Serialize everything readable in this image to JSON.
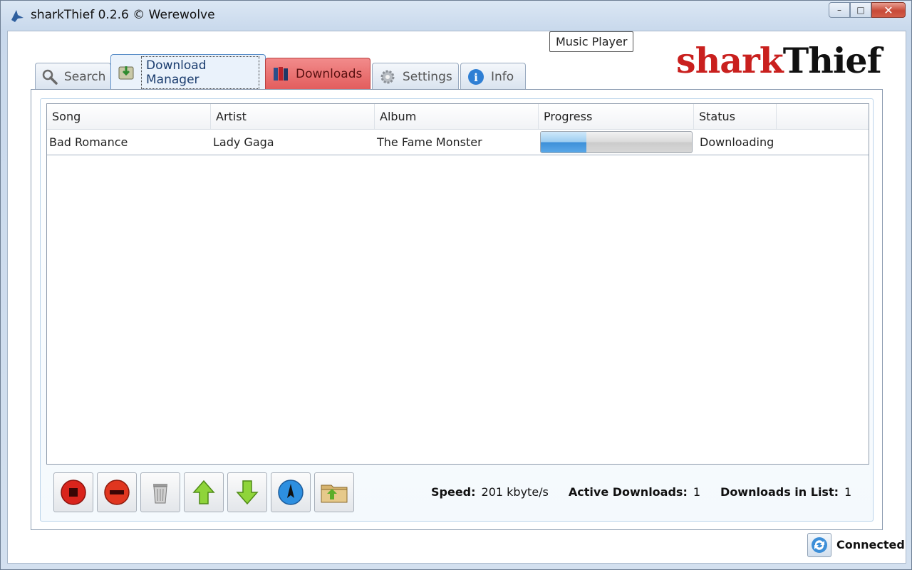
{
  "window": {
    "title": "sharkThief 0.2.6  © Werewolve",
    "controls": {
      "minimize": "–",
      "maximize": "□",
      "close": "✕"
    }
  },
  "tooltip": "Music Player",
  "logo": {
    "part1": "shark",
    "part2": "Thief",
    "colors": {
      "part1": "#c9201e",
      "part2": "#111111"
    }
  },
  "tabs": [
    {
      "label": "Search",
      "icon": "magnifier-icon"
    },
    {
      "label": "Download Manager",
      "icon": "download-manager-icon",
      "active": true
    },
    {
      "label": "Downloads",
      "icon": "books-icon"
    },
    {
      "label": "Settings",
      "icon": "gear-icon"
    },
    {
      "label": "Info",
      "icon": "info-icon"
    }
  ],
  "grid": {
    "columns": [
      "Song",
      "Artist",
      "Album",
      "Progress",
      "Status"
    ],
    "rows": [
      {
        "song": "Bad Romance",
        "artist": "Lady Gaga",
        "album": "The Fame Monster",
        "progress": 0.3,
        "status": "Downloading"
      }
    ]
  },
  "toolbar": {
    "buttons": [
      {
        "icon": "stop-icon"
      },
      {
        "icon": "remove-icon"
      },
      {
        "icon": "trash-icon"
      },
      {
        "icon": "move-up-icon"
      },
      {
        "icon": "move-down-icon"
      },
      {
        "icon": "compass-icon"
      },
      {
        "icon": "open-folder-icon"
      }
    ]
  },
  "stats": {
    "speed_label": "Speed:",
    "speed_value": "201 kbyte/s",
    "active_label": "Active Downloads:",
    "active_value": "1",
    "list_label": "Downloads in List:",
    "list_value": "1"
  },
  "status": {
    "connection": "Connected",
    "icon": "refresh-icon"
  }
}
